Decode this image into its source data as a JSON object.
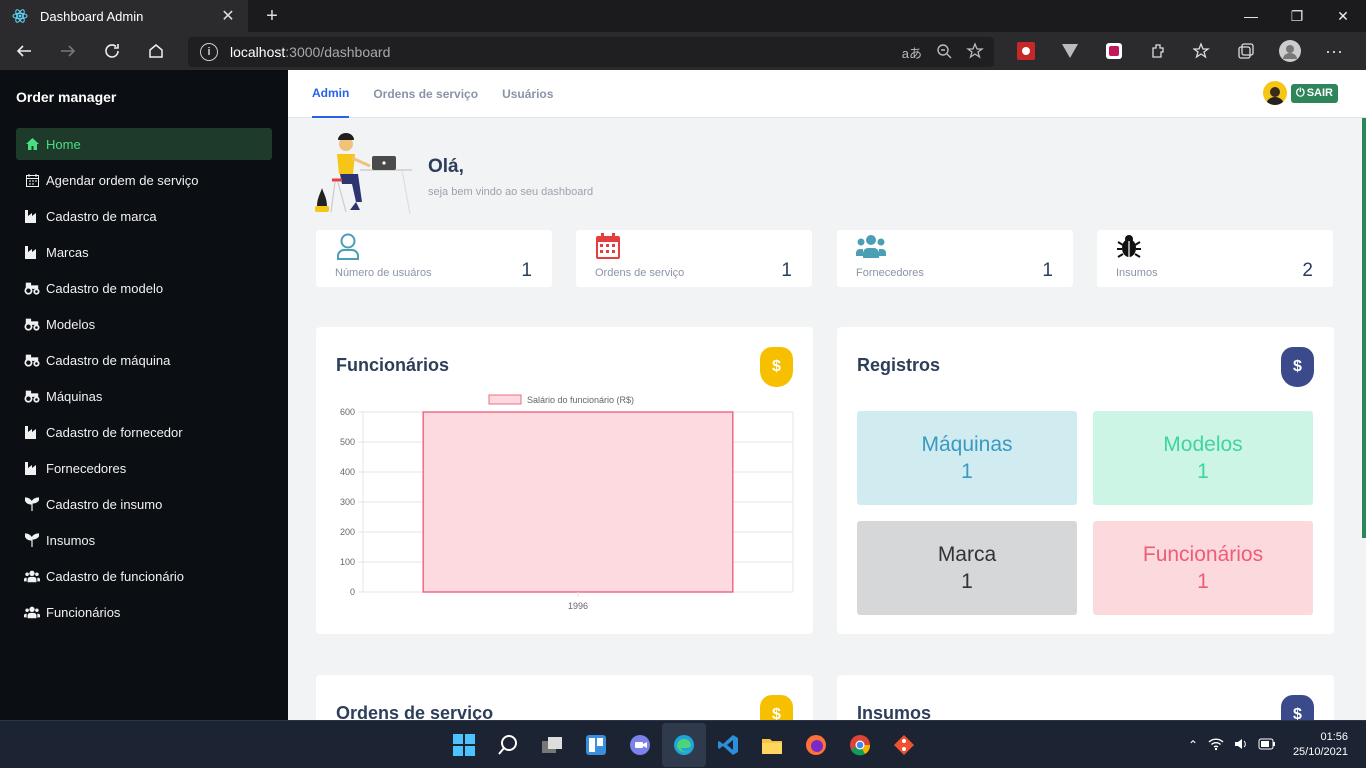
{
  "browser": {
    "tab_title": "Dashboard Admin",
    "url_host": "localhost",
    "url_path": ":3000/dashboard"
  },
  "sidebar": {
    "title": "Order manager",
    "items": [
      {
        "label": "Home",
        "icon": "home-icon"
      },
      {
        "label": "Agendar ordem de serviço",
        "icon": "calendar-icon"
      },
      {
        "label": "Cadastro de marca",
        "icon": "industry-icon"
      },
      {
        "label": "Marcas",
        "icon": "industry-icon"
      },
      {
        "label": "Cadastro de modelo",
        "icon": "tractor-icon"
      },
      {
        "label": "Modelos",
        "icon": "tractor-icon"
      },
      {
        "label": "Cadastro de máquina",
        "icon": "tractor-icon"
      },
      {
        "label": "Máquinas",
        "icon": "tractor-icon"
      },
      {
        "label": "Cadastro de fornecedor",
        "icon": "industry-icon"
      },
      {
        "label": "Fornecedores",
        "icon": "industry-icon"
      },
      {
        "label": "Cadastro de insumo",
        "icon": "seedling-icon"
      },
      {
        "label": "Insumos",
        "icon": "seedling-icon"
      },
      {
        "label": "Cadastro de funcionário",
        "icon": "users-icon"
      },
      {
        "label": "Funcionários",
        "icon": "users-icon"
      }
    ]
  },
  "topnav": {
    "tabs": [
      "Admin",
      "Ordens de serviço",
      "Usuários"
    ],
    "logout_label": "SAIR"
  },
  "welcome": {
    "title": "Olá,",
    "subtitle": "seja bem vindo ao seu dashboard"
  },
  "stats": [
    {
      "label": "Número de usuáros",
      "value": "1",
      "icon": "user-icon",
      "color": "#4a9fb5"
    },
    {
      "label": "Ordens de serviço",
      "value": "1",
      "icon": "calendar-icon",
      "color": "#e53e3e"
    },
    {
      "label": "Fornecedores",
      "value": "1",
      "icon": "users-icon",
      "color": "#4a9fb5"
    },
    {
      "label": "Insumos",
      "value": "2",
      "icon": "bug-icon",
      "color": "#111111"
    }
  ],
  "funcionarios_card": {
    "title": "Funcionários",
    "badge": "$"
  },
  "registros_card": {
    "title": "Registros",
    "badge": "$",
    "tiles": [
      {
        "label": "Máquinas",
        "value": "1"
      },
      {
        "label": "Modelos",
        "value": "1"
      },
      {
        "label": "Marca",
        "value": "1"
      },
      {
        "label": "Funcionários",
        "value": "1"
      }
    ]
  },
  "bottom_cards": [
    {
      "title": "Ordens de serviço",
      "badge": "$"
    },
    {
      "title": "Insumos",
      "badge": "$"
    }
  ],
  "chart_data": {
    "type": "bar",
    "categories": [
      "1996"
    ],
    "series": [
      {
        "name": "Salário do funcionário (R$)",
        "values": [
          600
        ]
      }
    ],
    "ylim": [
      0,
      600
    ],
    "yticks": [
      0,
      100,
      200,
      300,
      400,
      500,
      600
    ],
    "grid": true,
    "legend": "top-center",
    "bar_fill": "#fdd9e0",
    "bar_stroke": "#f06b85"
  },
  "colors": {
    "accent_blue": "#2563eb",
    "sidebar_active_bg": "#1e3a2b",
    "sidebar_active_text": "#4ade80",
    "badge_yellow": "#f6c000",
    "badge_navy": "#3b4a8a",
    "logout_green": "#2f855a"
  },
  "taskbar": {
    "time": "01:56",
    "date": "25/10/2021"
  }
}
